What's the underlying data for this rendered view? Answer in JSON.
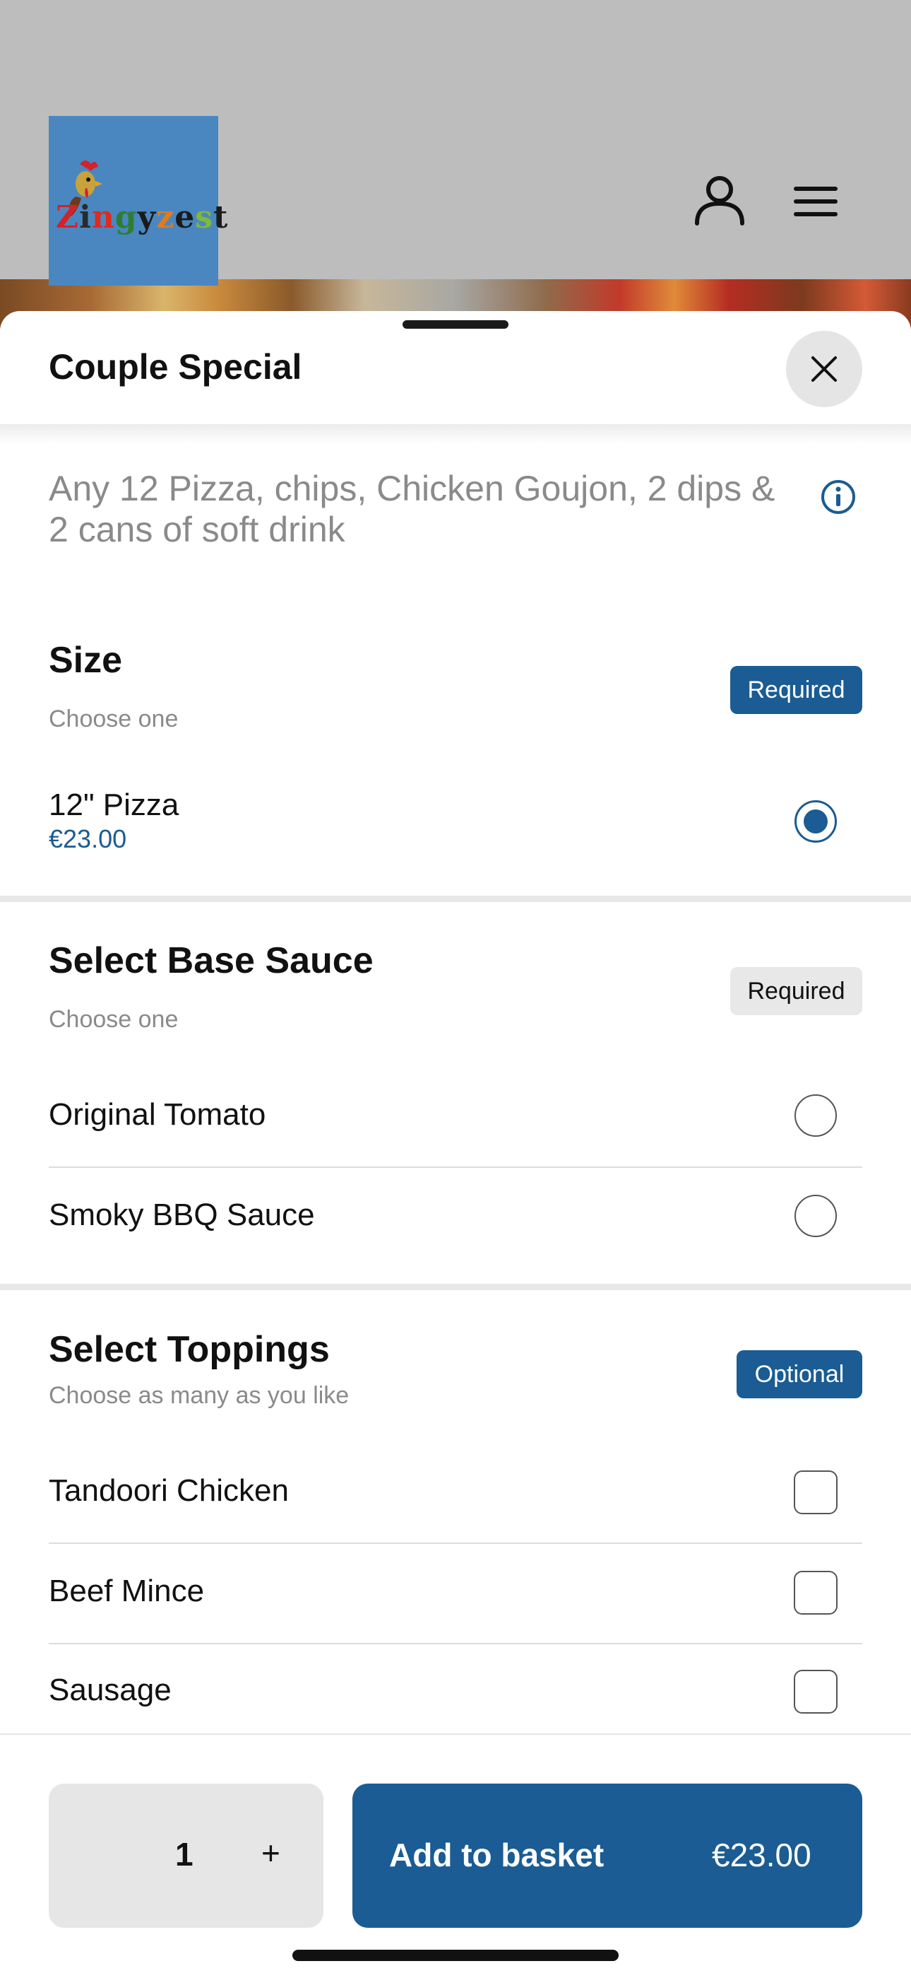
{
  "header": {
    "brand_logo_text": [
      "Z",
      "i",
      "n",
      "g",
      "y",
      "z",
      "e",
      "s",
      "t"
    ],
    "colors": {
      "background": "#bdbdbd",
      "logo_bg": "#4a87c0"
    }
  },
  "sheet": {
    "title": "Couple Special",
    "description": "Any 12 Pizza, chips, Chicken Goujon, 2 dips & 2 cans of soft drink",
    "sections": [
      {
        "title": "Size",
        "subtitle": "Choose one",
        "badge": "Required",
        "options": [
          {
            "label": "12\" Pizza",
            "price": "€23.00",
            "selected": true
          }
        ]
      },
      {
        "title": "Select Base Sauce",
        "subtitle": "Choose one",
        "badge": "Required",
        "options": [
          {
            "label": "Original Tomato",
            "selected": false
          },
          {
            "label": "Smoky BBQ Sauce",
            "selected": false
          }
        ]
      },
      {
        "title": "Select Toppings",
        "subtitle": "Choose as many as you like",
        "badge": "Optional",
        "options": [
          {
            "label": "Tandoori Chicken",
            "checked": false
          },
          {
            "label": "Beef Mince",
            "checked": false
          },
          {
            "label": "Sausage",
            "checked": false
          }
        ]
      }
    ]
  },
  "footer": {
    "quantity": "1",
    "plus": "+",
    "add_label": "Add to basket",
    "add_price": "€23.00"
  },
  "colors": {
    "accent": "#1a5c93",
    "muted_badge": "#e8e8e8",
    "text_muted": "#8a8a8a"
  }
}
